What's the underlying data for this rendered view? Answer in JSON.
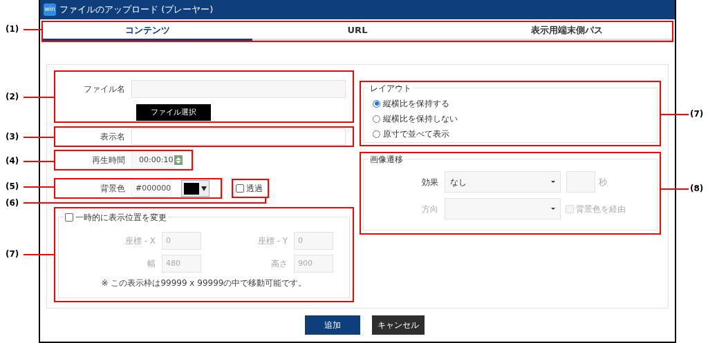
{
  "window": {
    "icon_text": "win",
    "title": "ファイルのアップロード (プレーヤー)"
  },
  "tabs": [
    {
      "label": "コンテンツ",
      "selected": true
    },
    {
      "label": "URL",
      "selected": false
    },
    {
      "label": "表示用端末側パス",
      "selected": false
    }
  ],
  "form": {
    "file_name": {
      "label": "ファイル名"
    },
    "file_button": "ファイル選択",
    "display_name": {
      "label": "表示名"
    },
    "duration": {
      "label": "再生時間",
      "value": "00:00:10"
    },
    "background": {
      "label": "背景色",
      "value": "#000000",
      "color": "#000000"
    },
    "transparent": {
      "label": "透過",
      "checked": false
    },
    "temp_position": {
      "label": "一時的に表示位置を変更",
      "checked": false,
      "fields": [
        {
          "label": "座標 - X",
          "value": "0"
        },
        {
          "label": "座標 - Y",
          "value": "0"
        },
        {
          "label": "幅",
          "value": "480"
        },
        {
          "label": "高さ",
          "value": "900"
        }
      ],
      "note": "※ この表示枠は99999 x 99999の中で移動可能です。"
    }
  },
  "layout": {
    "legend": "レイアウト",
    "options": [
      {
        "label": "縦横比を保持する",
        "selected": true
      },
      {
        "label": "縦横比を保持しない",
        "selected": false
      },
      {
        "label": "原寸で並べて表示",
        "selected": false
      }
    ]
  },
  "transition": {
    "legend": "画像遷移",
    "effect": {
      "label": "効果",
      "value": "なし"
    },
    "seconds_unit": "秒",
    "direction": {
      "label": "方向",
      "disabled": true
    },
    "via_background": {
      "label": "背景色を経由",
      "checked": false,
      "disabled": true
    }
  },
  "buttons": [
    {
      "label": "追加",
      "kind": "primary"
    },
    {
      "label": "キャンセル",
      "kind": "secondary"
    }
  ],
  "callouts": [
    {
      "label": "(1)",
      "kind": "left"
    },
    {
      "label": "(2)",
      "kind": "left"
    },
    {
      "label": "(3)",
      "kind": "left"
    },
    {
      "label": "(4)",
      "kind": "left"
    },
    {
      "label": "(5)",
      "kind": "left"
    },
    {
      "label": "(6)",
      "kind": "left"
    },
    {
      "label": "(7)",
      "kind": "left"
    },
    {
      "label": "(7)",
      "kind": "right"
    },
    {
      "label": "(8)",
      "kind": "right"
    }
  ]
}
